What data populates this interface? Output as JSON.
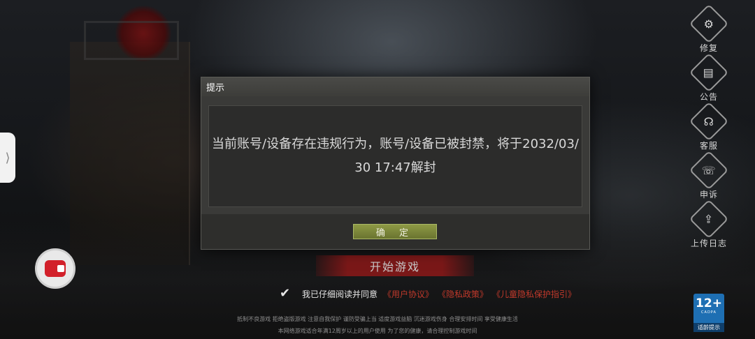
{
  "dialog": {
    "title": "提示",
    "message": "当前账号/设备存在违规行为，账号/设备已被封禁，将于2032/03/30 17:47解封",
    "confirm_label": "确 定"
  },
  "side_menu": [
    {
      "label": "修复",
      "icon": "gear-icon"
    },
    {
      "label": "公告",
      "icon": "announcement-icon"
    },
    {
      "label": "客服",
      "icon": "customer-service-icon"
    },
    {
      "label": "申诉",
      "icon": "appeal-icon"
    },
    {
      "label": "上传日志",
      "icon": "upload-log-icon"
    }
  ],
  "start_button": "开始游戏",
  "agreement": {
    "prefix": "我已仔细阅读并同意",
    "user_agreement": "《用户协议》",
    "privacy_policy": "《隐私政策》",
    "child_privacy": "《儿童隐私保护指引》"
  },
  "health_notice": {
    "line1": "抵制不良游戏 拒绝盗版游戏 注意自我保护 谨防受骗上当 适度游戏益脑 沉迷游戏伤身 合理安排时间 享受健康生活",
    "line2": "本网络游戏适合年满12周岁以上的用户使用  为了您的健康，请合理控制游戏时间"
  },
  "age_rating": {
    "number": "12+",
    "sub": "CADPA",
    "label": "适龄提示"
  },
  "colors": {
    "dialog_bg": "#3a3a38",
    "confirm_btn": "#7e8a3a",
    "link_red": "#c0392b",
    "age_blue": "#1e6fb3"
  }
}
